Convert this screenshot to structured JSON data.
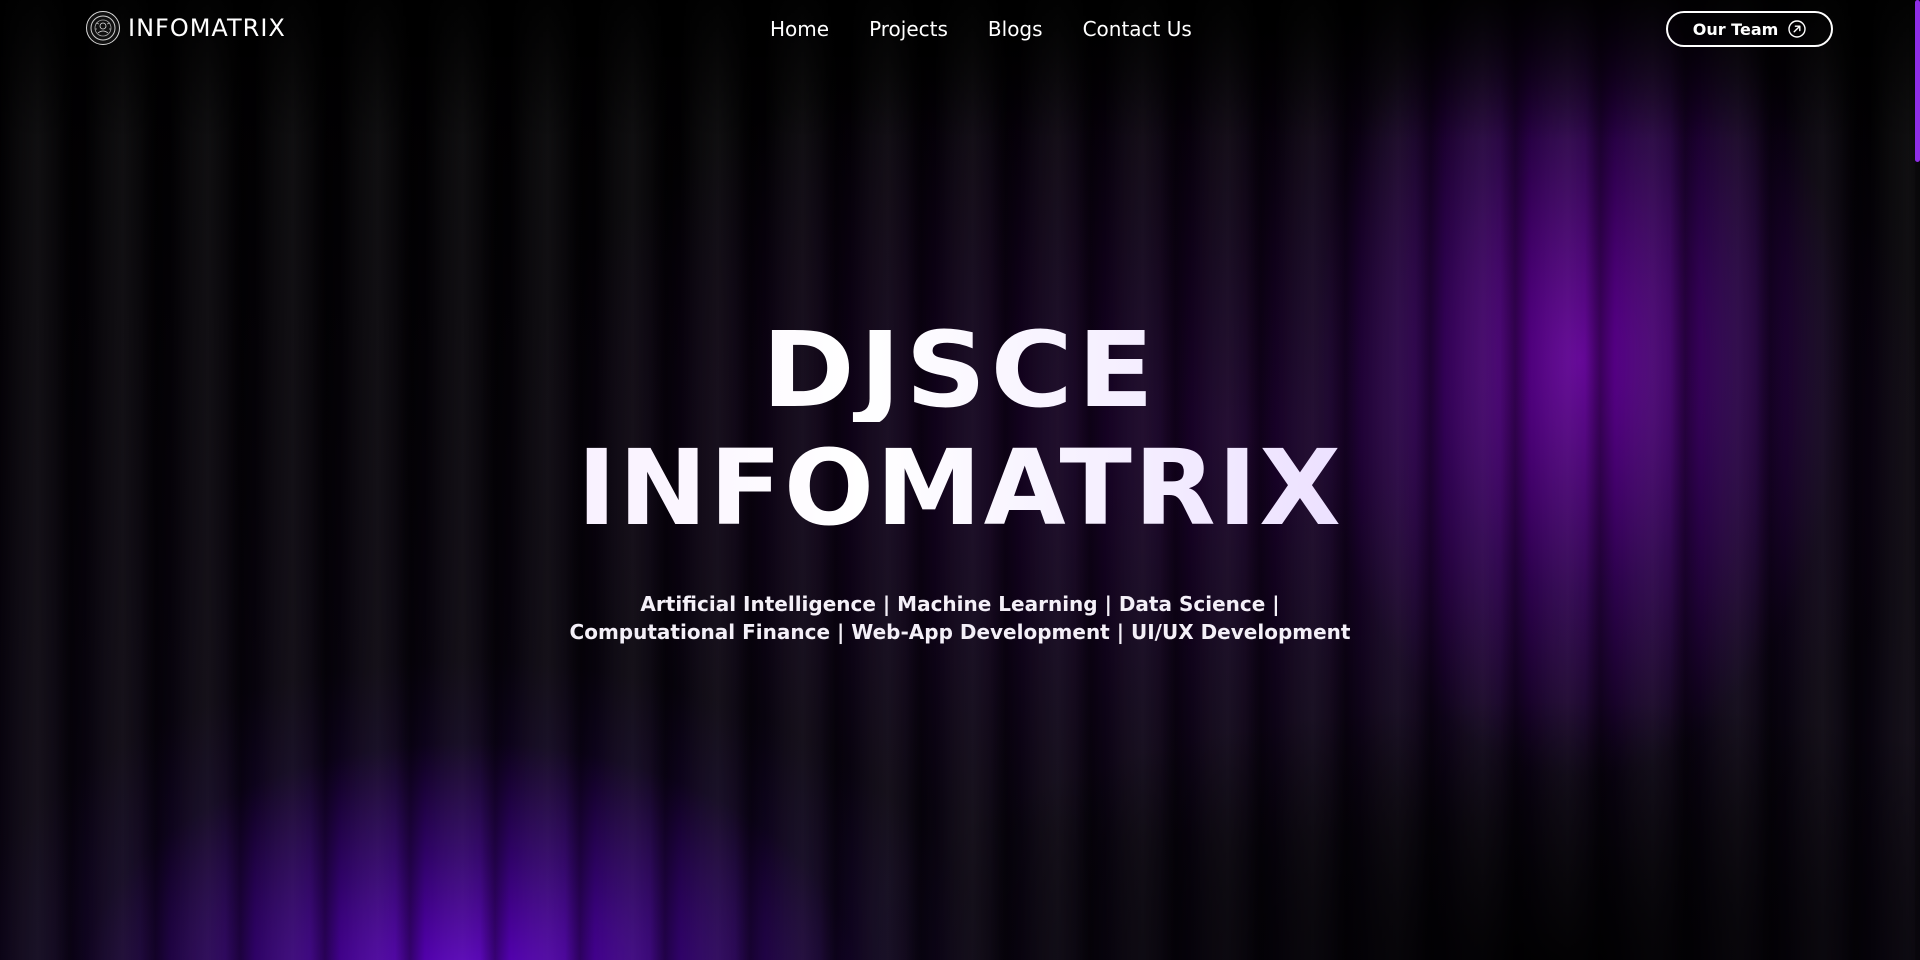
{
  "navbar": {
    "brand_name": "INFOMATRIX",
    "brand_logo_icon": "club-emblem-icon",
    "links": [
      {
        "label": "Home"
      },
      {
        "label": "Projects"
      },
      {
        "label": "Blogs"
      },
      {
        "label": "Contact Us"
      }
    ],
    "team_button": {
      "label": "Our Team",
      "icon": "arrow-up-right-circle-icon"
    }
  },
  "hero": {
    "title_line_1": "DJSCE",
    "title_line_2": "INFOMATRIX",
    "subtitle_line_1": "Artificial Intelligence | Machine Learning | Data Science |",
    "subtitle_line_2": "Computational Finance | Web-App Development | UI/UX Development"
  },
  "theme": {
    "background": "#000000",
    "accent_purple": "#6a00d6",
    "scroll_thumb": "#8f2ee6",
    "text": "#ffffff"
  }
}
